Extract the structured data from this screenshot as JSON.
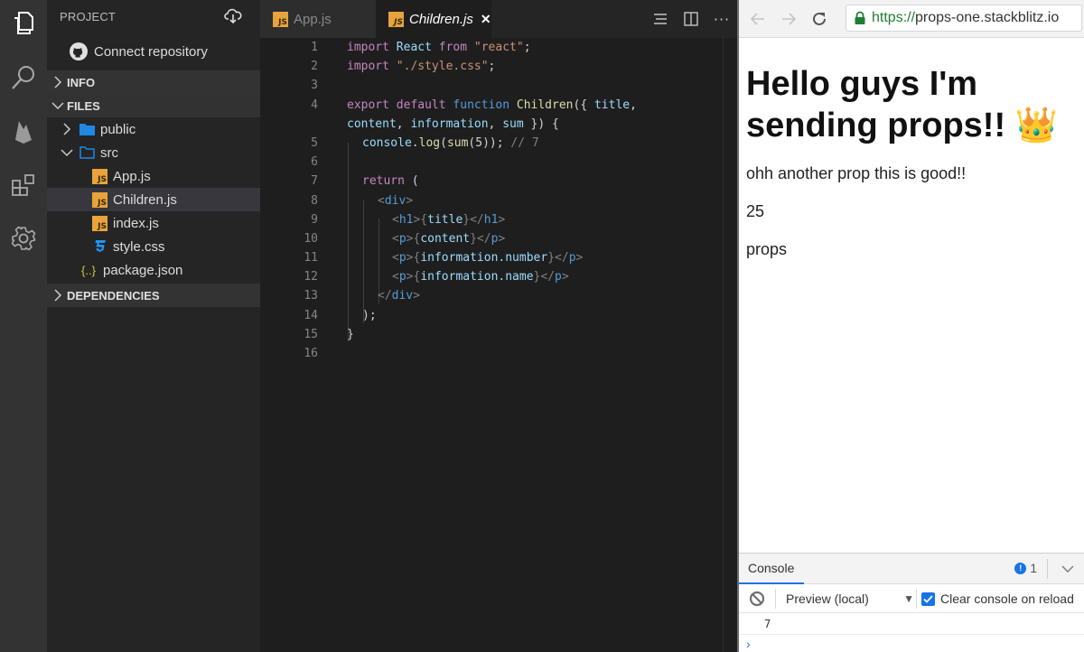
{
  "activity_bar": {
    "items": [
      {
        "name": "explorer",
        "icon": "files-icon"
      },
      {
        "name": "search",
        "icon": "search-icon"
      },
      {
        "name": "firebase",
        "icon": "firebase-icon"
      },
      {
        "name": "extensions",
        "icon": "extensions-icon"
      },
      {
        "name": "settings",
        "icon": "gear-icon"
      }
    ]
  },
  "sidebar": {
    "header": "PROJECT",
    "connect_repo": "Connect repository",
    "sections": {
      "info": "INFO",
      "files": "FILES",
      "dependencies": "DEPENDENCIES"
    },
    "tree": [
      {
        "label": "public",
        "type": "folder",
        "expanded": false
      },
      {
        "label": "src",
        "type": "folder",
        "expanded": true
      },
      {
        "label": "App.js",
        "type": "js"
      },
      {
        "label": "Children.js",
        "type": "js",
        "selected": true
      },
      {
        "label": "index.js",
        "type": "js"
      },
      {
        "label": "style.css",
        "type": "css"
      },
      {
        "label": "package.json",
        "type": "json"
      }
    ]
  },
  "editor": {
    "tabs": [
      {
        "label": "App.js",
        "active": false
      },
      {
        "label": "Children.js",
        "active": true,
        "close": "✕"
      }
    ],
    "line_numbers": [
      "1",
      "2",
      "3",
      "4",
      "",
      "5",
      "6",
      "7",
      "8",
      "9",
      "10",
      "11",
      "12",
      "13",
      "14",
      "15",
      "16"
    ],
    "code": {
      "l1": [
        "import",
        " ",
        "React",
        " ",
        "from",
        " ",
        "\"react\"",
        ";"
      ],
      "l2": [
        "import",
        " ",
        "\"./style.css\"",
        ";"
      ],
      "l4a": [
        "export",
        " ",
        "default",
        " ",
        "function",
        " ",
        "Children",
        "({ ",
        "title",
        ","
      ],
      "l4b": [
        "content",
        ", ",
        "information",
        ", ",
        "sum",
        " }) {"
      ],
      "l5": [
        "console",
        ".",
        "log",
        "(",
        "sum",
        "(5)); ",
        "// 7"
      ],
      "l7": [
        "return",
        " ("
      ],
      "l8": [
        "<",
        "div",
        ">"
      ],
      "l9": [
        "<",
        "h1",
        ">{",
        "title",
        "}</",
        "h1",
        ">"
      ],
      "l10": [
        "<",
        "p",
        ">{",
        "content",
        "}</",
        "p",
        ">"
      ],
      "l11": [
        "<",
        "p",
        ">{",
        "information.number",
        "}</",
        "p",
        ">"
      ],
      "l12": [
        "<",
        "p",
        ">{",
        "information.name",
        "}</",
        "p",
        ">"
      ],
      "l13": [
        "</",
        "div",
        ">"
      ],
      "l14": [
        ");"
      ],
      "l15": [
        "}"
      ]
    }
  },
  "browser": {
    "url_scheme": "https://",
    "url_host": "props-one.stackblitz.io",
    "preview": {
      "title": "Hello guys I'm sending props!! 👑",
      "content": "ohh another prop this is good!!",
      "number": "25",
      "name": "props"
    },
    "console": {
      "tab_label": "Console",
      "issue_count": "1",
      "context": "Preview (local)",
      "clear_on_reload_label": "Clear console on reload",
      "clear_on_reload_checked": true,
      "output": [
        "7"
      ],
      "prompt": "›"
    }
  }
}
